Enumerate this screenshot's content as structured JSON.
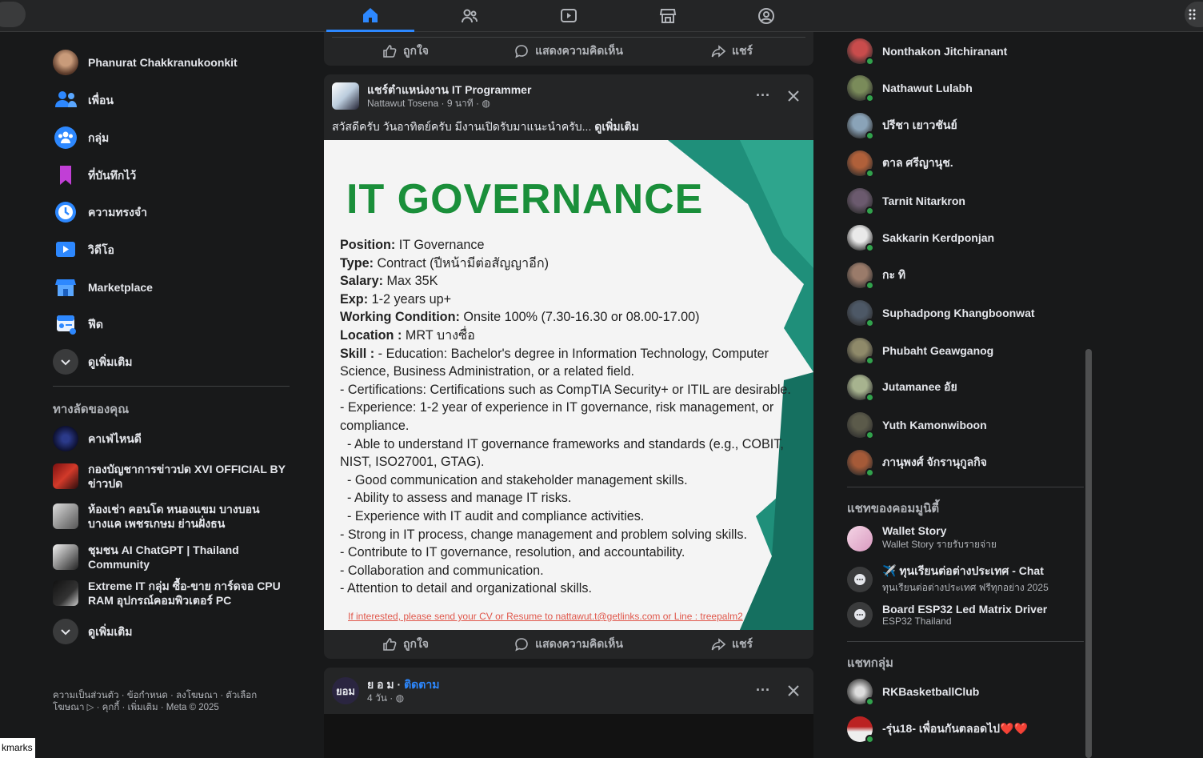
{
  "colors": {
    "accent": "#2d88ff",
    "online": "#31a24c",
    "brand_green": "#1a8f3a"
  },
  "top_nav": {
    "tabs": [
      {
        "icon": "home-icon",
        "active": true
      },
      {
        "icon": "friends-icon",
        "active": false
      },
      {
        "icon": "video-icon",
        "active": false
      },
      {
        "icon": "marketplace-icon",
        "active": false
      },
      {
        "icon": "gaming-icon",
        "active": false
      }
    ]
  },
  "left_menu": {
    "profile_name": "Phanurat Chakkranukoonkit",
    "items": [
      {
        "label": "เพื่อน",
        "icon": "friends-icon"
      },
      {
        "label": "กลุ่ม",
        "icon": "groups-icon"
      },
      {
        "label": "ที่บันทึกไว้",
        "icon": "bookmark-icon"
      },
      {
        "label": "ความทรงจำ",
        "icon": "memories-icon"
      },
      {
        "label": "วิดีโอ",
        "icon": "video-icon"
      },
      {
        "label": "Marketplace",
        "icon": "marketplace-icon"
      },
      {
        "label": "ฟีด",
        "icon": "feed-icon"
      }
    ],
    "see_more": "ดูเพิ่มเติม",
    "shortcuts_title": "ทางลัดของคุณ",
    "shortcuts": [
      {
        "label": "คาเฟ่ไหนดี"
      },
      {
        "label": "กองบัญชาการข่าวปด XVI OFFICIAL BY ข่าวปด"
      },
      {
        "label": "ห้องเช่า คอนโด หนองแขม บางบอน บางแค เพชรเกษม ย่านฝั่งธน"
      },
      {
        "label": "ชุมชน AI ChatGPT | Thailand Community"
      },
      {
        "label": "Extreme IT กลุ่ม ซื้อ-ขาย การ์ดจอ CPU RAM อุปกรณ์คอมพิวเตอร์ PC"
      }
    ],
    "shortcuts_see_more": "ดูเพิ่มเติม",
    "footer_line1": "ความเป็นส่วนตัว · ข้อกำหนด · ลงโฆษณา · ตัวเลือก",
    "footer_line2": "โฆษณา ▷ · คุกกี้ · เพิ่มเติม · Meta © 2025",
    "bookmarks_tip": "kmarks"
  },
  "actions": {
    "like": "ถูกใจ",
    "comment": "แสดงความคิดเห็น",
    "share": "แชร์"
  },
  "post1": {
    "group": "แชร์ตำแหน่งงาน IT Programmer",
    "author_meta": "Nattawut Tosena · 9 นาที · ",
    "text": "สวัสดีครับ วันอาทิตย์ครับ มีงานเปิดรับมาแนะนำครับ... ",
    "see_more": "ดูเพิ่มเติม",
    "image": {
      "headline": "IT GOVERNANCE",
      "position_label": "Position:",
      "position": " IT Governance",
      "type_label": "Type:",
      "type": " Contract (ปีหน้ามีต่อสัญญาอีก)",
      "salary_label": "Salary:",
      "salary": " Max 35K",
      "exp_label": "Exp:",
      "exp": "  1-2  years up+",
      "condition_label": "Working Condition:",
      "condition": "  Onsite 100% (7.30-16.30 or 08.00-17.00)",
      "location_label": "Location :",
      "location": " MRT บางซื่อ",
      "skill_label": "Skill :",
      "skill": " - Education: Bachelor's degree in Information Technology, Computer Science, Business Administration, or a related field.",
      "bullets": [
        "- Certifications: Certifications such as CompTIA Security+ or ITIL are desirable.",
        "- Experience: 1-2 year of experience in IT governance, risk management, or compliance.",
        "  - Able to understand IT governance frameworks and standards (e.g., COBIT, NIST, ISO27001, GTAG).",
        "  - Good communication and stakeholder management skills.",
        "  - Ability to assess and manage IT risks.",
        "  - Experience with IT audit and compliance activities.",
        "- Strong in IT process, change management and problem solving skills.",
        "- Contribute to IT governance, resolution, and accountability.",
        "- Collaboration and communication.",
        "- Attention to detail and organizational skills."
      ],
      "footer": "If interested, please send your CV or Resume to   nattawut.t@getlinks.com or Line :   treepalm2"
    }
  },
  "post2": {
    "name": "ย อ ม",
    "follow": "ติดตาม",
    "meta": "4 วัน · ",
    "avatar_text": "ยอม"
  },
  "contacts": [
    {
      "name": "Nonthakon Jitchiranant",
      "color": "#c94c4c"
    },
    {
      "name": "Nathawut Lulabh",
      "color": "#7a8b5a"
    },
    {
      "name": "ปรีชา เยาวชันย์",
      "color": "#8aa3b8"
    },
    {
      "name": "ตาล ศรีญานุช.",
      "color": "#b0603a"
    },
    {
      "name": "Tarnit Nitarkron",
      "color": "#6b5a6e"
    },
    {
      "name": "Sakkarin Kerdponjan",
      "color": "#e9e9e9"
    },
    {
      "name": "กะ ทิ",
      "color": "#9a7b6a"
    },
    {
      "name": "Suphadpong Khangboonwat",
      "color": "#4d5866"
    },
    {
      "name": "Phubaht Geawganog",
      "color": "#8f8a6a"
    },
    {
      "name": "Jutamanee อัย",
      "color": "#a7b38f"
    },
    {
      "name": "Yuth Kamonwiboon",
      "color": "#5b5a4a"
    },
    {
      "name": "ภานุพงศ์ จักรานุกูลกิจ",
      "color": "#a55a38"
    }
  ],
  "community_title": "แชทของคอมมูนิตี้",
  "community_chats": [
    {
      "name": "Wallet Story",
      "sub": "Wallet Story รายรับรายจ่าย"
    },
    {
      "name": "✈️ ทุนเรียนต่อต่างประเทศ - Chat",
      "sub": "ทุนเรียนต่อต่างประเทศ ฟรีทุกอย่าง 2025"
    },
    {
      "name": "Board ESP32 Led Matrix Driver",
      "sub": "ESP32 Thailand"
    }
  ],
  "group_title": "แชทกลุ่ม",
  "group_chats": [
    {
      "name": "RKBasketballClub"
    },
    {
      "name": "-รุ่น18- เพื่อนกันตลอดไป❤️❤️"
    }
  ]
}
